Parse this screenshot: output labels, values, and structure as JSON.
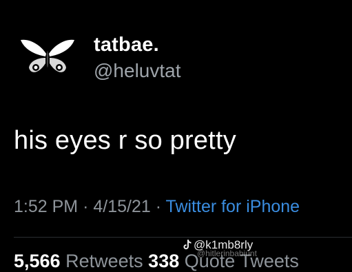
{
  "tweet": {
    "display_name": "tatbae.",
    "handle": "@heluvtat",
    "text": "his eyes r so pretty",
    "time": "1:52 PM",
    "separator": "·",
    "date": "4/15/21",
    "source": "Twitter for iPhone",
    "avatar_icon": "butterfly-icon"
  },
  "stats": {
    "retweets_count": "5,566",
    "retweets_label": "Retweets",
    "quotes_count": "338",
    "quotes_label": "Quote Tweets"
  },
  "watermark": {
    "icon": "tiktok-icon",
    "text": "@k1mb8rly",
    "subtext": "@hitlerinbabiunt"
  },
  "colors": {
    "background": "#000000",
    "text_primary": "#ffffff",
    "text_secondary": "#8e949a",
    "accent": "#3a8de0"
  }
}
